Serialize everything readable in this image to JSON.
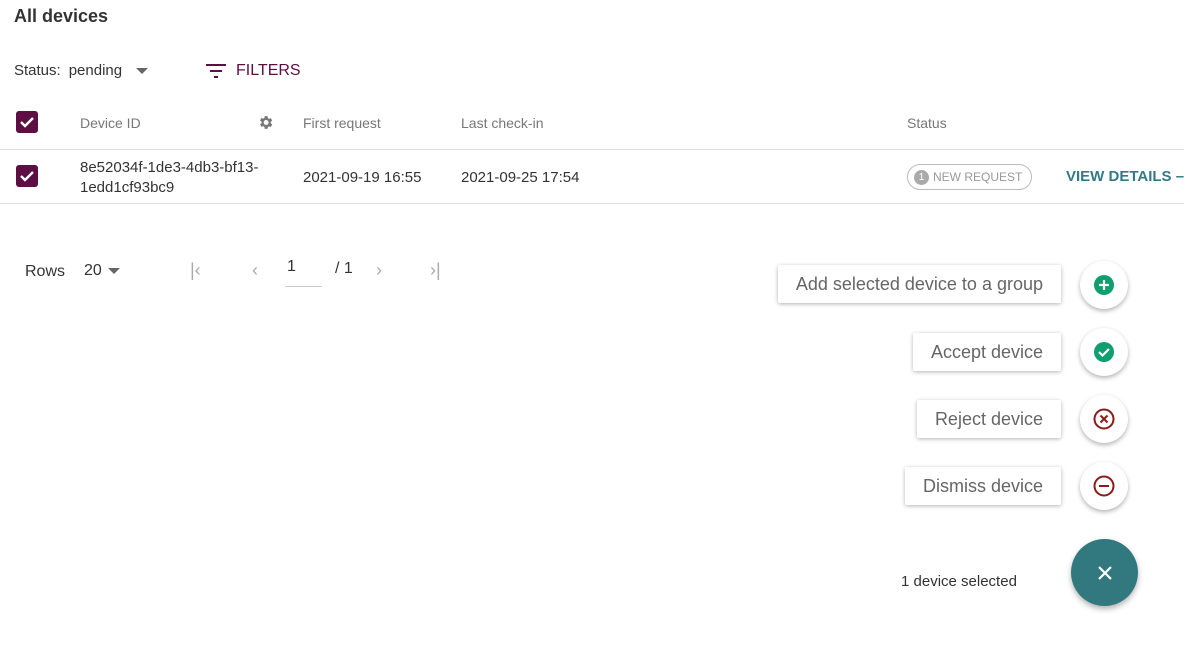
{
  "page_title": "All devices",
  "status_filter": {
    "label": "Status:",
    "value": "pending"
  },
  "filters_label": "FILTERS",
  "table": {
    "headers": {
      "device_id": "Device ID",
      "first_request": "First request",
      "last_checkin": "Last check-in",
      "status": "Status"
    },
    "rows": [
      {
        "device_id_1": "8e52034f-1de3-4db3-bf13-",
        "device_id_2": "1edd1cf93bc9",
        "first_request": "2021-09-19 16:55",
        "last_checkin": "2021-09-25 17:54",
        "badge_count": "1",
        "badge_label": "NEW REQUEST",
        "action": "VIEW DETAILS",
        "selected": true
      }
    ]
  },
  "pagination": {
    "rows_label": "Rows",
    "rows_value": "20",
    "page": "1",
    "total": "/ 1"
  },
  "actions": [
    {
      "label": "Add selected device to a group",
      "icon": "add-circle-icon",
      "color": "#0f9e6e"
    },
    {
      "label": "Accept device",
      "icon": "check-circle-icon",
      "color": "#0f9e6e"
    },
    {
      "label": "Reject device",
      "icon": "cancel-circle-icon",
      "color": "#8b1a1a"
    },
    {
      "label": "Dismiss device",
      "icon": "remove-circle-icon",
      "color": "#8b1a1a"
    }
  ],
  "selection_text": "1 device selected",
  "colors": {
    "primary": "#5d0f43",
    "secondary": "#337a87"
  }
}
